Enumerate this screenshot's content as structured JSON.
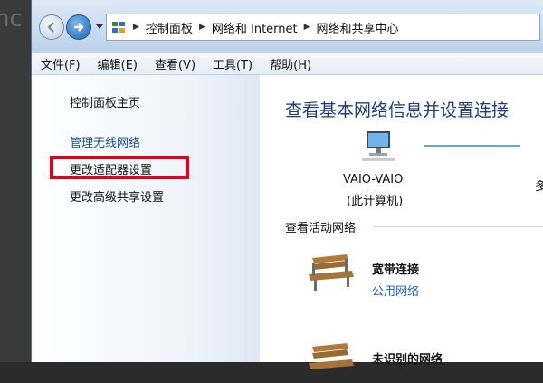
{
  "background": {
    "partial_text": "hc"
  },
  "address_bar": {
    "breadcrumbs": [
      "控制面板",
      "网络和 Internet",
      "网络和共享中心"
    ]
  },
  "menu": [
    "文件(F)",
    "编辑(E)",
    "查看(V)",
    "工具(T)",
    "帮助(H)"
  ],
  "sidebar": {
    "home": "控制面板主页",
    "links": [
      "管理无线网络",
      "更改适配器设置",
      "更改高级共享设置"
    ]
  },
  "main": {
    "title": "查看基本网络信息并设置连接",
    "computer_name": "VAIO-VAIO",
    "computer_sub": "(此计算机)",
    "clipped_text": "多",
    "active_label": "查看活动网络",
    "networks": [
      {
        "name": "宽带连接",
        "type": "公用网络"
      },
      {
        "name": "未识别的网络"
      }
    ]
  },
  "colors": {
    "highlight": "#e3001b",
    "link": "#1f63b4",
    "title": "#1e3e73"
  }
}
